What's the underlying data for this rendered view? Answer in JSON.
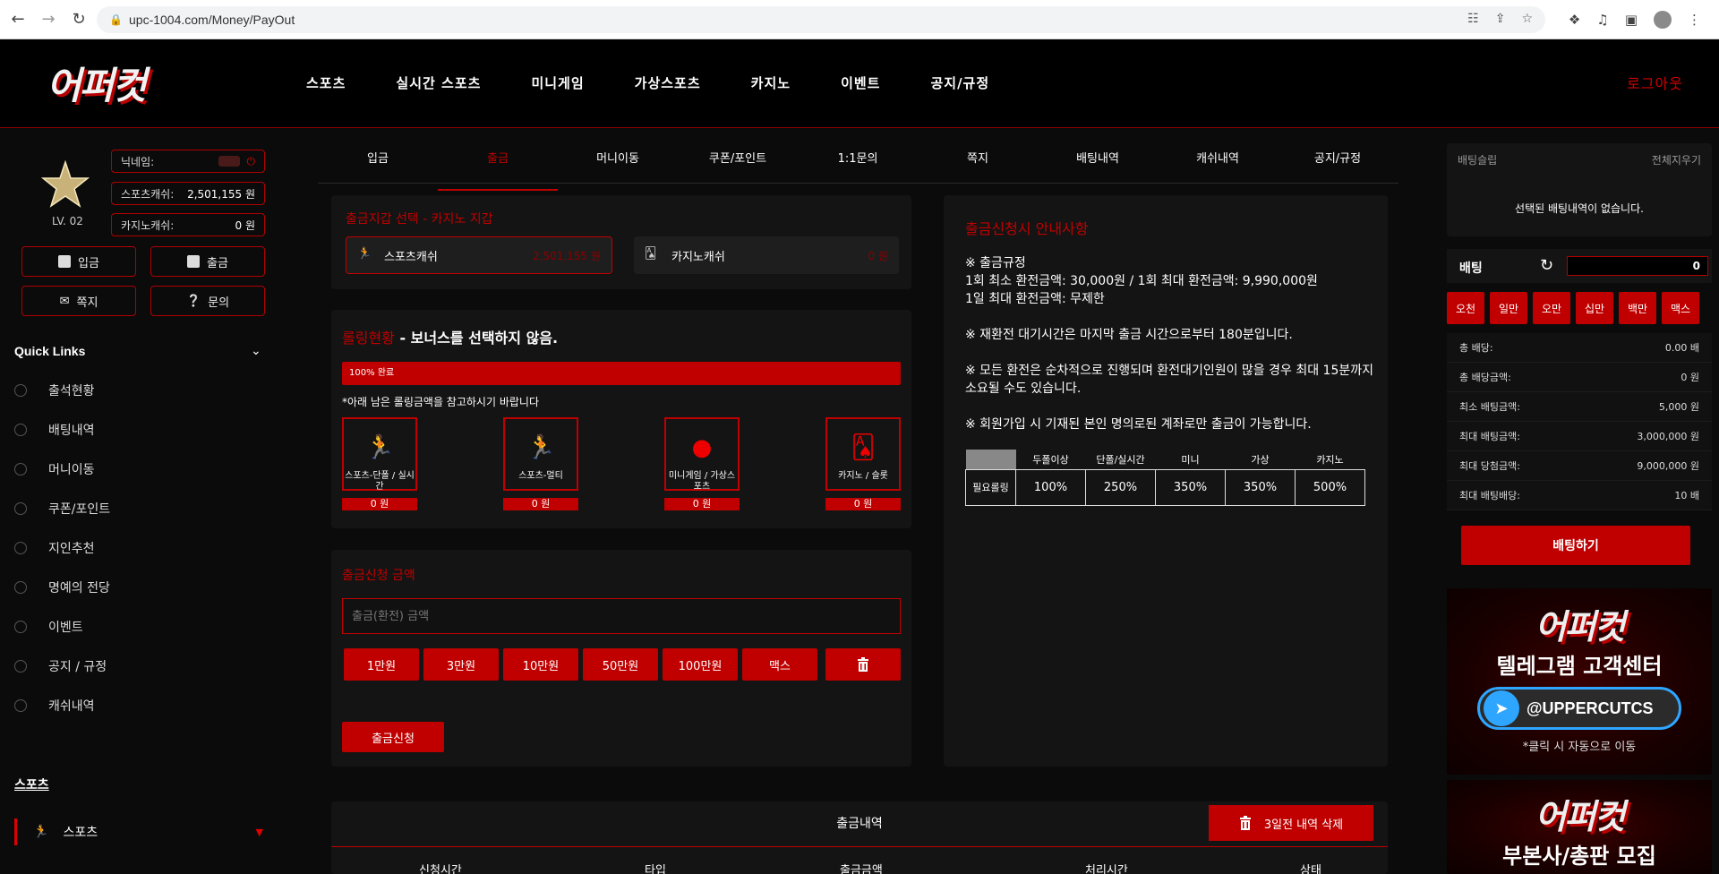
{
  "browser": {
    "url": "upc-1004.com/Money/PayOut"
  },
  "header": {
    "logo_text": "어퍼컷",
    "nav": [
      "스포츠",
      "실시간 스포츠",
      "미니게임",
      "가상스포츠",
      "카지노",
      "이벤트",
      "공지/규정"
    ],
    "logout": "로그아웃"
  },
  "user": {
    "level": "LV. 02",
    "nickname_label": "닉네임:",
    "sports_cash_label": "스포츠캐쉬:",
    "sports_cash_value": "2,501,155 원",
    "casino_cash_label": "카지노캐쉬:",
    "casino_cash_value": "0 원"
  },
  "sidebar": {
    "buttons": [
      "입금",
      "출금",
      "쪽지",
      "문의"
    ],
    "quick_links_title": "Quick Links",
    "quick_links": [
      "출석현황",
      "배팅내역",
      "머니이동",
      "쿠폰/포인트",
      "지인추천",
      "명예의 전당",
      "이벤트",
      "공지 / 규정",
      "캐쉬내역"
    ],
    "sports_section": "스포츠",
    "sports_item": "스포츠"
  },
  "tabs": [
    "입금",
    "출금",
    "머니이동",
    "쿠폰/포인트",
    "1:1문의",
    "쪽지",
    "배팅내역",
    "캐쉬내역",
    "공지/규정"
  ],
  "active_tab": "출금",
  "wallet_select": {
    "title": "출금지갑 선택 - 카지노 지갑",
    "sports": {
      "label": "스포츠캐쉬",
      "amount": "2,501,155 원"
    },
    "casino": {
      "label": "카지노캐쉬",
      "amount": "0 원"
    }
  },
  "rolling": {
    "title_red": "롤링현황",
    "title_white": " - 보너스를 선택하지 않음.",
    "progress_text": "100% 완료",
    "progress_percent": 100,
    "note": "*아래 남은 롤링금액을 참고하시기 바랍니다",
    "games": [
      {
        "label": "스포츠-단폴 / 실시간",
        "amount": "0 원",
        "icon": "runner-icon"
      },
      {
        "label": "스포츠-멀티",
        "amount": "0 원",
        "icon": "runner-icon"
      },
      {
        "label": "미니게임 / 가상스포츠",
        "amount": "0 원",
        "icon": "ball-icon"
      },
      {
        "label": "카지노 / 슬롯",
        "amount": "0 원",
        "icon": "cards-icon"
      }
    ]
  },
  "withdraw_form": {
    "title": "출금신청 금액",
    "placeholder": "출금(환전) 금액",
    "amount_buttons": [
      "1만원",
      "3만원",
      "10만원",
      "50만원",
      "100만원",
      "맥스"
    ],
    "submit": "출금신청"
  },
  "guide": {
    "title": "출금신청시 안내사항",
    "lines": [
      "※ 출금규정\n1회 최소 환전금액: 30,000원 / 1회 최대 환전금액: 9,990,000원\n1일 최대 환전금액: 무제한",
      "※ 재환전 대기시간은 마지막 출금 시간으로부터 180분입니다.",
      "※ 모든 환전은 순차적으로 진행되며 환전대기인원이 많을 경우 최대 15분까지 소요될 수도 있습니다.",
      "※ 회원가입 시 기재된 본인 명의로된 계좌로만 출금이 가능합니다."
    ],
    "table": {
      "headers": [
        "두폴이상",
        "단폴/실시간",
        "미니",
        "가상",
        "카지노"
      ],
      "row_label": "필요롤링",
      "values": [
        "100%",
        "250%",
        "350%",
        "350%",
        "500%"
      ]
    }
  },
  "history": {
    "title": "출금내역",
    "delete_button": "3일전 내역 삭제",
    "columns": [
      "신청시간",
      "타입",
      "출금금액",
      "처리시간",
      "상태"
    ]
  },
  "betslip": {
    "title": "배팅슬립",
    "clear": "전체지우기",
    "empty": "선택된 배팅내역이 없습니다.",
    "bet_label": "배팅",
    "bet_value": "0",
    "chips": [
      "오천",
      "일만",
      "오만",
      "십만",
      "백만",
      "맥스"
    ],
    "stats": [
      {
        "label": "총 배당:",
        "value": "0.00 배"
      },
      {
        "label": "총 배당금액:",
        "value": "0 원"
      },
      {
        "label": "최소 배팅금액:",
        "value": "5,000 원"
      },
      {
        "label": "최대 배팅금액:",
        "value": "3,000,000 원"
      },
      {
        "label": "최대 당첨금액:",
        "value": "9,000,000 원"
      },
      {
        "label": "최대 배팅배당:",
        "value": "10 배"
      }
    ],
    "place_bet": "배팅하기"
  },
  "banners": [
    {
      "logo": "어퍼컷",
      "title": "텔레그램 고객센터",
      "handle": "@UPPERCUTCS",
      "note": "*클릭 시 자동으로 이동"
    },
    {
      "logo": "어퍼컷",
      "title": "부본사/총판 모집"
    }
  ]
}
